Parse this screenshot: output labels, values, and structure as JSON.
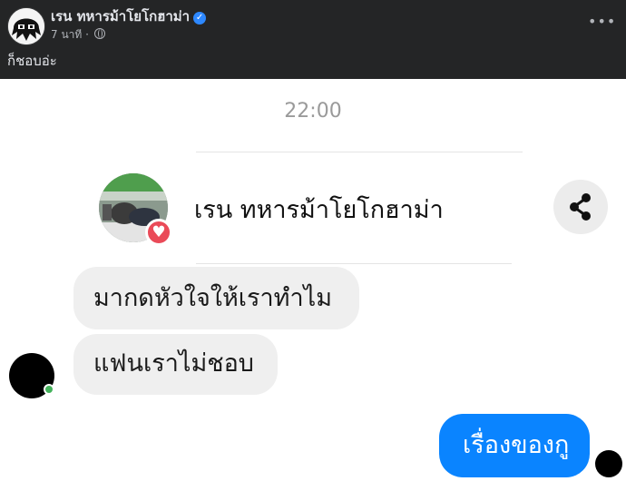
{
  "post": {
    "author": "เรน ทหารม้าโยโกฮาม่า",
    "time_label": "7 นาที",
    "separator": "·",
    "more_label": "•••",
    "caption": "ก็ชอบอ่ะ",
    "icons": {
      "verified": "verified-badge-icon",
      "privacy": "globe-icon",
      "more": "more-options-icon"
    }
  },
  "chat": {
    "timestamp": "22:00",
    "profile_name": "เรน ทหารม้าโยโกฮาม่า",
    "badge_glyph": "♥",
    "messages_incoming": [
      "มากดหัวใจให้เราทำไม",
      "แฟนเราไม่ชอบ"
    ],
    "message_outgoing": "เรื่องของกู",
    "icons": {
      "share": "share-icon",
      "reaction": "heart-icon"
    }
  },
  "colors": {
    "header_bg": "#242526",
    "outgoing_bubble": "#0a84ff",
    "incoming_bubble": "#efefef",
    "verified": "#2d88ff",
    "online": "#44b25b",
    "heart_badge": "#ea4a58"
  }
}
